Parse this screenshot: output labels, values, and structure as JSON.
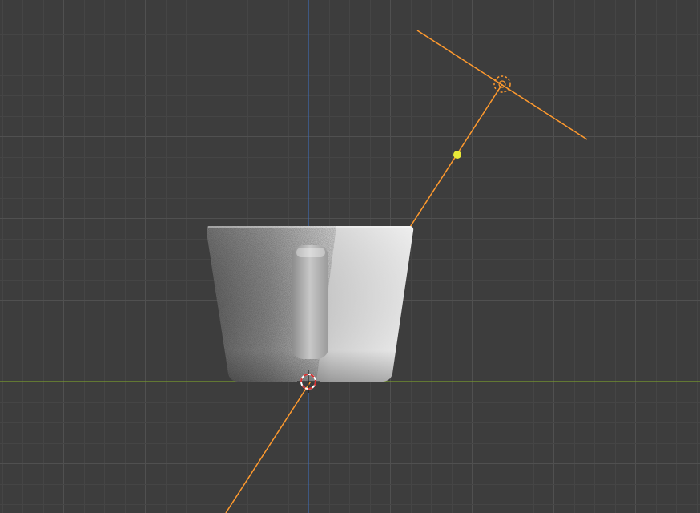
{
  "viewport": {
    "view": "front-orthographic",
    "background_color": "#3d3d3d",
    "grid_minor_color": "#454545",
    "grid_major_color": "#505050",
    "x_axis_color": "#7a9b2e",
    "z_axis_color": "#3f6bb0",
    "grid": true
  },
  "scene": {
    "objects": [
      {
        "name": "mug",
        "type": "mesh",
        "shading": "rendered",
        "color_light": "#f0f0f0",
        "color_dark": "#5a5a5a"
      },
      {
        "name": "light",
        "type": "spot-light",
        "selected": true,
        "color": "#ff9a2e",
        "target_dot_color": "#e8e838"
      },
      {
        "name": "3d-cursor",
        "type": "cursor",
        "colors": [
          "#d83030",
          "#ffffff"
        ]
      }
    ]
  }
}
